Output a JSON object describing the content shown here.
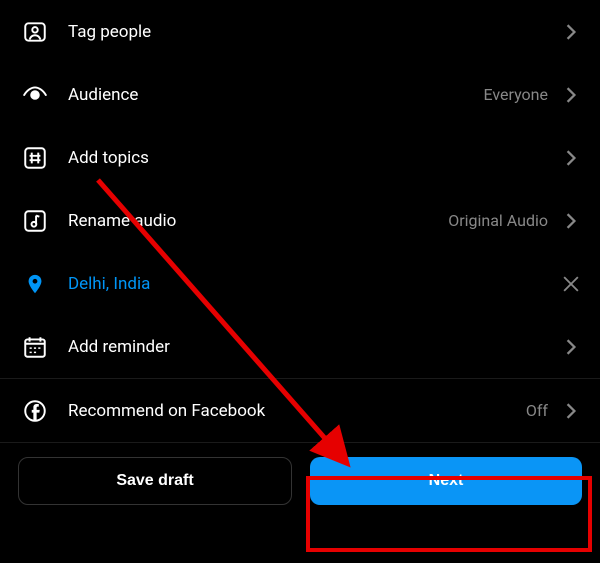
{
  "options": {
    "tag_people": {
      "label": "Tag people"
    },
    "audience": {
      "label": "Audience",
      "value": "Everyone"
    },
    "add_topics": {
      "label": "Add topics"
    },
    "rename_audio": {
      "label": "Rename audio",
      "value": "Original Audio"
    },
    "location": {
      "label": "Delhi, India"
    },
    "add_reminder": {
      "label": "Add reminder"
    },
    "recommend_facebook": {
      "label": "Recommend on Facebook",
      "value": "Off"
    }
  },
  "buttons": {
    "save_draft": "Save draft",
    "next": "Next"
  },
  "colors": {
    "accent": "#0095f6",
    "highlight": "#e60000"
  }
}
